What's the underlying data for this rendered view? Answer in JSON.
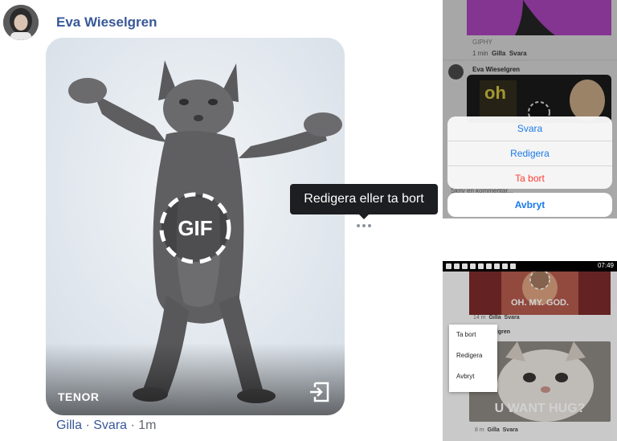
{
  "main_comment": {
    "author": "Eva Wieselgren",
    "gif": {
      "provider": "TENOR",
      "badge": "GIF"
    },
    "actions": {
      "like": "Gilla",
      "separator": "·",
      "reply": "Svara",
      "time": "1m"
    },
    "tooltip": "Redigera eller ta bort",
    "more_icon": "ellipsis-icon",
    "open_icon": "open-link-icon"
  },
  "ios_panel": {
    "previous_post": {
      "source": "GIPHY",
      "time": "1 min",
      "like": "Gilla",
      "reply": "Svara"
    },
    "comment_author": "Eva Wieselgren",
    "gif_text": "oh my",
    "behind_text": "Skriv en kommentar...",
    "sheet_options": [
      "Svara",
      "Redigera",
      "Ta bort"
    ],
    "cancel": "Avbryt"
  },
  "android_panel": {
    "status_time": "07:49",
    "gif_caption_1": "OH. MY. GOD.",
    "meta_1": {
      "time": "14 m",
      "like": "Gilla",
      "reply": "Svara"
    },
    "author_partial": "elgren",
    "gif_caption_2": "U WANT HUG?",
    "meta_2": {
      "time": "8 m",
      "like": "Gilla",
      "reply": "Svara"
    },
    "menu_options": [
      "Ta bort",
      "Redigera",
      "Avbryt"
    ]
  },
  "colors": {
    "link_blue": "#385898",
    "ios_blue": "#1a7ae8",
    "ios_red": "#ff3b30",
    "tooltip_bg": "#1c1e21"
  }
}
